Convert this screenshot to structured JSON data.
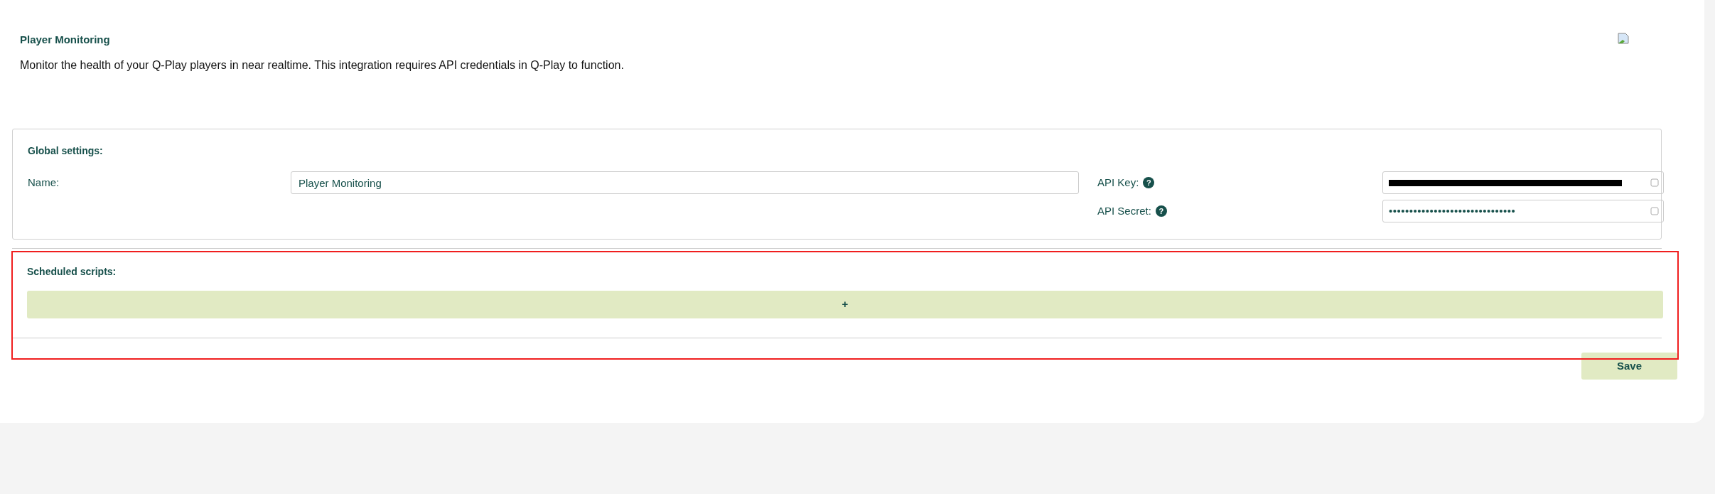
{
  "header": {
    "title": "Player Monitoring",
    "description": "Monitor the health of your Q-Play players in near realtime. This integration requires API credentials in Q-Play to function."
  },
  "global_settings": {
    "title": "Global settings:",
    "name": {
      "label": "Name:",
      "value": "Player Monitoring"
    },
    "api_key": {
      "label": "API Key:",
      "help": "?",
      "redacted": true
    },
    "api_secret": {
      "label": "API Secret:",
      "help": "?",
      "value": "•••••••••••••••••••••••••••••••"
    }
  },
  "scheduled_scripts": {
    "title": "Scheduled scripts:",
    "add_button": "+",
    "highlighted": true
  },
  "save_button": "Save"
}
